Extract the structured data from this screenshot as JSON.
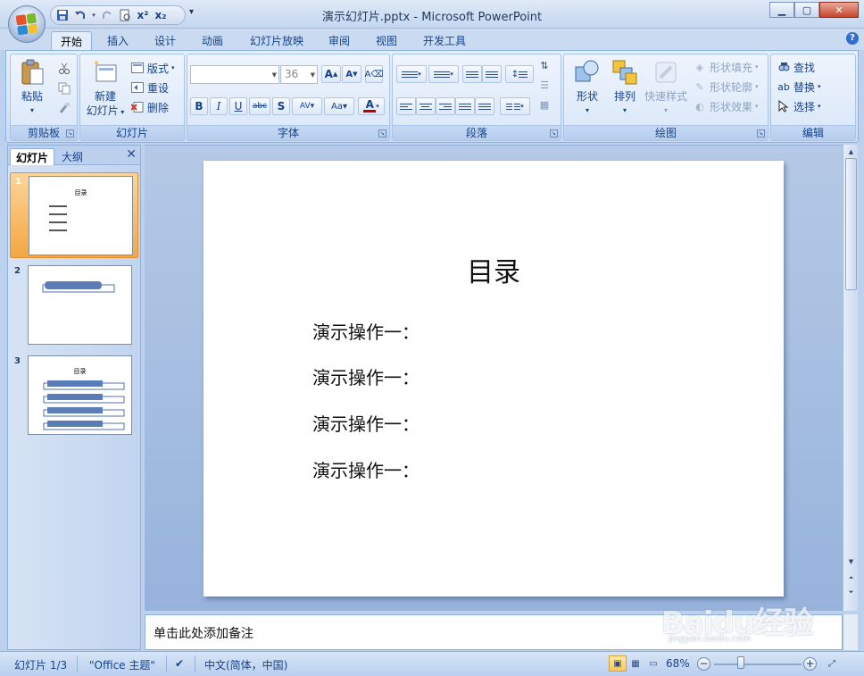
{
  "window": {
    "title": "演示幻灯片.pptx - Microsoft PowerPoint"
  },
  "quick_access": {
    "items": [
      "save-icon",
      "undo-icon",
      "redo-icon",
      "print-preview-icon",
      "superscript-icon",
      "subscript-icon"
    ],
    "superscript_label": "x²",
    "subscript_label": "x₂"
  },
  "ribbon_tabs": [
    "开始",
    "插入",
    "设计",
    "动画",
    "幻灯片放映",
    "审阅",
    "视图",
    "开发工具"
  ],
  "ribbon": {
    "clipboard": {
      "paste_label": "粘贴",
      "group_label": "剪贴板"
    },
    "slides": {
      "new_slide_line1": "新建",
      "new_slide_line2": "幻灯片",
      "layout_label": "版式",
      "reset_label": "重设",
      "delete_label": "删除",
      "group_label": "幻灯片"
    },
    "font": {
      "font_name": "",
      "font_size": "36",
      "group_label": "字体"
    },
    "paragraph": {
      "group_label": "段落"
    },
    "drawing": {
      "shapes_label": "形状",
      "arrange_label": "排列",
      "quick_styles_label": "快速样式",
      "shape_fill_label": "形状填充",
      "shape_outline_label": "形状轮廓",
      "shape_effects_label": "形状效果",
      "group_label": "绘图"
    },
    "editing": {
      "find_label": "查找",
      "replace_label": "替换",
      "select_label": "选择",
      "group_label": "编辑"
    }
  },
  "left_pane": {
    "tab_slides": "幻灯片",
    "tab_outline": "大纲",
    "slides": [
      {
        "number": "1",
        "title": "目录",
        "selected": true
      },
      {
        "number": "2",
        "title": "",
        "selected": false
      },
      {
        "number": "3",
        "title": "目录",
        "selected": false
      }
    ]
  },
  "slide": {
    "title": "目录",
    "bullets": [
      "演示操作一：",
      "演示操作一：",
      "演示操作一：",
      "演示操作一："
    ]
  },
  "notes": {
    "placeholder": "单击此处添加备注"
  },
  "status_bar": {
    "slide_info": "幻灯片 1/3",
    "theme": "\"Office 主题\"",
    "language": "中文(简体，中国)",
    "zoom": "68%"
  },
  "watermark": {
    "brand": "Baidu经验",
    "url": "jingyan.baidu.com"
  },
  "colors": {
    "ribbon_blue": "#15428b",
    "selected_slide": "#f4a743",
    "close_red": "#c7452c"
  }
}
